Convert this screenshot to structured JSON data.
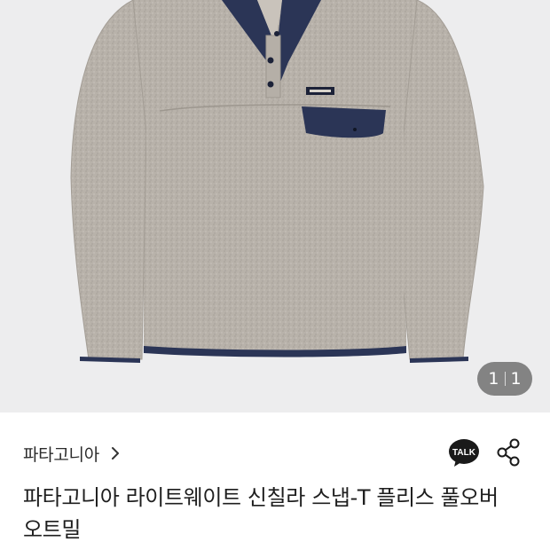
{
  "image_counter": {
    "current": "1",
    "total": "1"
  },
  "product": {
    "brand": "파타고니아",
    "title_line1": "파타고니아 라이트웨이트 신칠라 스냅-T 플리스 풀오버",
    "title_line2": "오트밀"
  },
  "icons": {
    "brand_link": "chevron-right-icon",
    "talk": "kakaotalk-icon",
    "talk_text": "TALK",
    "share": "share-icon"
  },
  "colors": {
    "image_background": "#ededee",
    "fleece": "#b8b2aa",
    "navy_trim": "#2b3556",
    "counter_background": "#707070"
  }
}
